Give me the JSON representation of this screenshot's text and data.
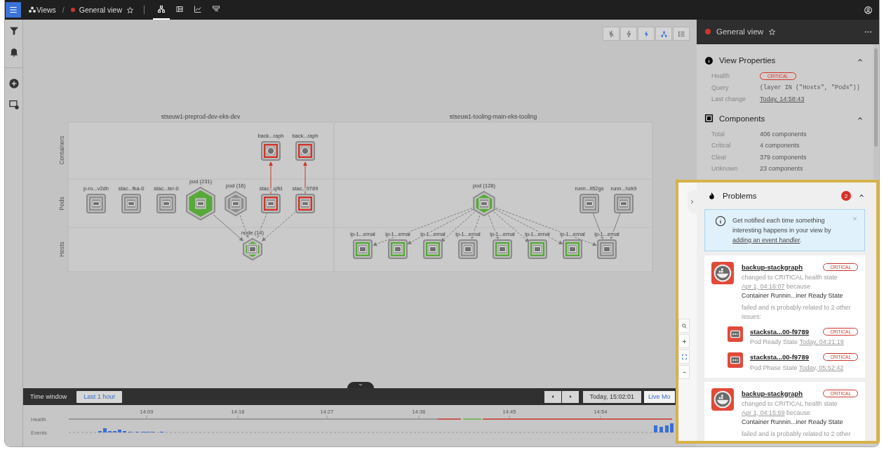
{
  "topbar": {
    "section": "Views",
    "separator": "/",
    "view_title": "General view",
    "view_critical": true,
    "starred": false,
    "tabs": [
      {
        "kind": "topology",
        "selected": true
      },
      {
        "kind": "components",
        "selected": false
      },
      {
        "kind": "metrics",
        "selected": false
      },
      {
        "kind": "events",
        "selected": false
      }
    ]
  },
  "sidebar": [
    {
      "kind": "filter"
    },
    {
      "kind": "bell"
    },
    {
      "kind": "add"
    },
    {
      "kind": "view-settings"
    }
  ],
  "canvas_toolbar": [
    {
      "kind": "bolt-off",
      "on": false
    },
    {
      "kind": "bolt-outline",
      "on": false
    },
    {
      "kind": "bolt",
      "on": true
    },
    {
      "kind": "tree",
      "on": true
    },
    {
      "kind": "list",
      "on": false
    }
  ],
  "topology": {
    "lanes": [
      "Containers",
      "Pods",
      "Hosts"
    ],
    "clusters": [
      {
        "title": "stseuw1-preprod-dev-eks-dev",
        "containers": [
          {
            "label": "back...raph",
            "kind": "container",
            "color": "#c9372c"
          },
          {
            "label": "back...raph",
            "kind": "container",
            "color": "#c9372c"
          }
        ],
        "pods": [
          {
            "label": "p-ro...v2dh",
            "kind": "pod",
            "color": "#8e8e8e"
          },
          {
            "label": "stac...fka-0",
            "kind": "pod",
            "color": "#8e8e8e"
          },
          {
            "label": "stac...ter-0",
            "kind": "pod",
            "color": "#8e8e8e"
          },
          {
            "label": "pod (231)",
            "kind": "pod-group",
            "color": "#58a83a"
          },
          {
            "label": "pod (16)",
            "kind": "pod-group",
            "color": "#8e8e8e"
          },
          {
            "label": "stac...q!fd",
            "kind": "pod",
            "color": "#c9372c"
          },
          {
            "label": "stac...9789",
            "kind": "pod",
            "color": "#c9372c"
          }
        ],
        "hosts": [
          {
            "label": "node (14)",
            "kind": "host-group",
            "color": "#58a83a"
          }
        ]
      },
      {
        "title": "stseuw1-tooling-main-eks-tooling",
        "pods": [
          {
            "label": "pod (128)",
            "kind": "pod-group",
            "color": "#58a83a"
          },
          {
            "label": "runn...ll52gs",
            "kind": "pod",
            "color": "#8e8e8e"
          },
          {
            "label": "runn...hzk9",
            "kind": "pod",
            "color": "#8e8e8e"
          }
        ],
        "hosts": [
          {
            "label": "ip-1...ernal",
            "kind": "host",
            "color": "#58a83a"
          },
          {
            "label": "ip-1...ernal",
            "kind": "host",
            "color": "#58a83a"
          },
          {
            "label": "ip-1...ernal",
            "kind": "host",
            "color": "#58a83a"
          },
          {
            "label": "ip-1...ernal",
            "kind": "host",
            "color": "#8e8e8e"
          },
          {
            "label": "ip-1...ernal",
            "kind": "host",
            "color": "#58a83a"
          },
          {
            "label": "ip-1...ernal",
            "kind": "host",
            "color": "#58a83a"
          },
          {
            "label": "ip-1...ernal",
            "kind": "host",
            "color": "#58a83a"
          },
          {
            "label": "ip-1...ernal",
            "kind": "host",
            "color": "#8e8e8e"
          }
        ]
      }
    ]
  },
  "zoom_controls": [
    {
      "kind": "search"
    },
    {
      "kind": "zoom-in"
    },
    {
      "kind": "fit"
    },
    {
      "kind": "zoom-out"
    }
  ],
  "view_panel": {
    "title": "General view",
    "color": "#c9372c",
    "starred": false,
    "sections": [
      {
        "title": "View Properties",
        "kind": "properties",
        "expanded": true,
        "rows": [
          {
            "label": "Health",
            "kind": "badge",
            "color": "#c9372c",
            "value": "CRITICAL"
          },
          {
            "label": "Query",
            "kind": "code",
            "value": "(layer IN (\"Hosts\", \"Pods\"))"
          },
          {
            "label": "Last change",
            "kind": "link",
            "value": "Today, 14:58:43"
          }
        ]
      },
      {
        "title": "Components",
        "kind": "components",
        "expanded": true,
        "rows": [
          {
            "label": "Total",
            "kind": "text",
            "value": "406 components"
          },
          {
            "label": "Critical",
            "kind": "text",
            "value": "4 components"
          },
          {
            "label": "Clear",
            "kind": "text",
            "value": "379 components"
          },
          {
            "label": "Unknown",
            "kind": "text",
            "value": "23 components"
          }
        ]
      }
    ]
  },
  "problems": {
    "title": "Problems",
    "count": "2",
    "expanded": true,
    "notice": {
      "text": "Get notified each time something interesting happens in your view by ",
      "link": "adding an event handler",
      "end": "."
    },
    "items": [
      {
        "name": "backup-stackgraph",
        "kind": "container",
        "color": "#c9372c",
        "badge": "CRITICAL",
        "message": "changed to CRITICAL health state",
        "time": "Apr 1, 04:16:07",
        "message_end": "because",
        "check": "Container Runnin...iner Ready State",
        "related_text": "failed and is probably related to 2 other issues:",
        "related": [
          {
            "name": "stacksta...00-f9789",
            "kind": "pod",
            "color": "#c9372c",
            "badge": "CRITICAL",
            "check": "Pod Ready State",
            "time": "Today, 04:21:19"
          },
          {
            "name": "stacksta...00-f9789",
            "kind": "pod",
            "color": "#c9372c",
            "badge": "CRITICAL",
            "check": "Pod Phase State",
            "time": "Today, 05:52:42"
          }
        ]
      },
      {
        "name": "backup-stackgraph",
        "kind": "container",
        "color": "#c9372c",
        "badge": "CRITICAL",
        "message": "changed to CRITICAL health state",
        "time": "Apr 1, 04:15:59",
        "message_end": "because",
        "check": "Container Runnin...iner Ready State",
        "related_text": "failed and is probably related to 2 other"
      }
    ]
  },
  "time_window": {
    "label": "Time window",
    "range": "Last 1 hour",
    "current_time": "Today, 15:02:01",
    "live_mode": "Live Mo"
  },
  "timeline": {
    "rows": [
      "Health",
      "Events"
    ],
    "ticks": [
      "14:09",
      "14:18",
      "14:27",
      "14:36",
      "14:45",
      "14:54"
    ]
  }
}
